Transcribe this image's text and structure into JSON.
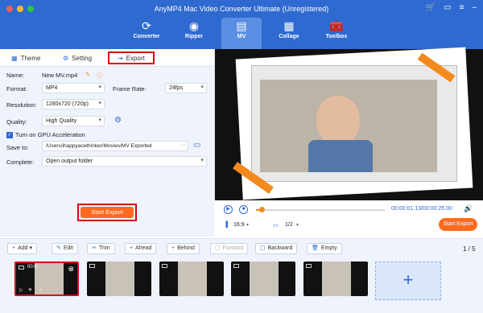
{
  "app": {
    "title": "AnyMP4 Mac Video Converter Ultimate (Unregistered)"
  },
  "nav": [
    {
      "label": "Converter",
      "icon": "converter-icon"
    },
    {
      "label": "Ripper",
      "icon": "ripper-icon"
    },
    {
      "label": "MV",
      "icon": "mv-icon"
    },
    {
      "label": "Collage",
      "icon": "collage-icon"
    },
    {
      "label": "Toolbox",
      "icon": "toolbox-icon"
    }
  ],
  "tabs": {
    "theme": "Theme",
    "setting": "Setting",
    "export": "Export"
  },
  "form": {
    "name_label": "Name:",
    "name_value": "New MV.mp4",
    "format_label": "Format:",
    "format_value": "MP4",
    "framerate_label": "Frame Rate:",
    "framerate_value": "24fps",
    "resolution_label": "Resolution:",
    "resolution_value": "1280x720 (720p)",
    "quality_label": "Quality:",
    "quality_value": "High Quality",
    "gpu_label": "Turn on GPU Acceleration",
    "saveto_label": "Save to:",
    "saveto_value": "/Users/ihappyacethinker/Movies/MV Exported",
    "saveto_dots": "···",
    "complete_label": "Complete:",
    "complete_value": "Open output folder"
  },
  "start_export_left": "Start Export",
  "player": {
    "time": "00:00:01.13/00:00:25.00",
    "aspect": "16:9",
    "page": "1/2",
    "start_export": "Start Export",
    "progress": 0.045
  },
  "timeline": {
    "buttons": {
      "add": "Add",
      "edit": "Edit",
      "trim": "Trim",
      "ahead": "Ahead",
      "behind": "Behind",
      "forward": "Forward",
      "backward": "Backward",
      "empty": "Empty"
    },
    "count": "1 / 5",
    "first_thumb_time": "00:0",
    "add_tile": "+"
  },
  "colors": {
    "brand": "#2f6ad0",
    "accent": "#ff6a1e",
    "highlight": "#d9001b"
  }
}
